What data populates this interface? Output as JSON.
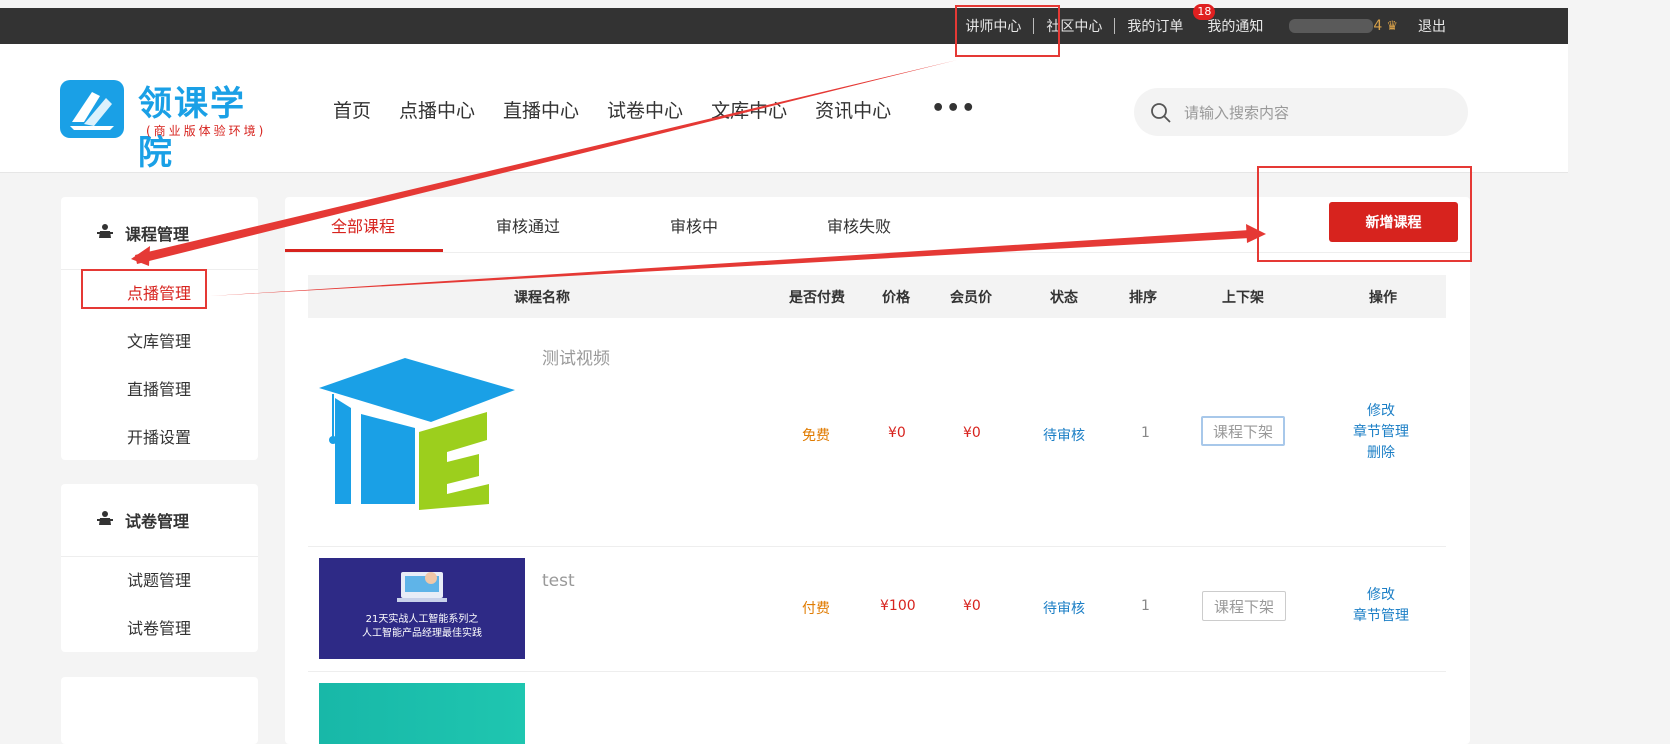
{
  "topbar": {
    "teacher_center": "讲师中心",
    "community": "社区中心",
    "orders": "我的订单",
    "notifications": "我的通知",
    "notification_count": "18",
    "level_num": "4",
    "logout": "退出"
  },
  "logo": {
    "name": "领课学院",
    "subtitle": "(商业版体验环境)"
  },
  "nav": {
    "items": [
      "首页",
      "点播中心",
      "直播中心",
      "试卷中心",
      "文库中心",
      "资讯中心"
    ],
    "more": "•••"
  },
  "search": {
    "placeholder": "请输入搜索内容"
  },
  "sidebar": {
    "course_box": {
      "title": "课程管理",
      "items": [
        "点播管理",
        "文库管理",
        "直播管理",
        "开播设置"
      ]
    },
    "exam_box": {
      "title": "试卷管理",
      "items": [
        "试题管理",
        "试卷管理"
      ]
    }
  },
  "tabs": [
    "全部课程",
    "审核通过",
    "审核中",
    "审核失败"
  ],
  "add_course_button": "新增课程",
  "table": {
    "headers": [
      "课程名称",
      "是否付费",
      "价格",
      "会员价",
      "状态",
      "排序",
      "上下架",
      "操作"
    ],
    "rows": [
      {
        "title": "测试视频",
        "paid": "免费",
        "price": "¥0",
        "member_price": "¥0",
        "status": "待审核",
        "sort": "1",
        "shelf": "课程下架",
        "actions": [
          "修改",
          "章节管理",
          "删除"
        ]
      },
      {
        "title": "test",
        "thumb_line1": "21天实战人工智能系列之",
        "thumb_line2": "人工智能产品经理最佳实践",
        "paid": "付费",
        "price": "¥100",
        "member_price": "¥0",
        "status": "待审核",
        "sort": "1",
        "shelf": "课程下架",
        "actions": [
          "修改",
          "章节管理"
        ]
      }
    ]
  },
  "colors": {
    "brand_blue": "#1aa0e6",
    "accent_red": "#d7231e",
    "annotation_red": "#e53935",
    "free_orange": "#e07b00",
    "status_blue": "#1c7fc6"
  }
}
